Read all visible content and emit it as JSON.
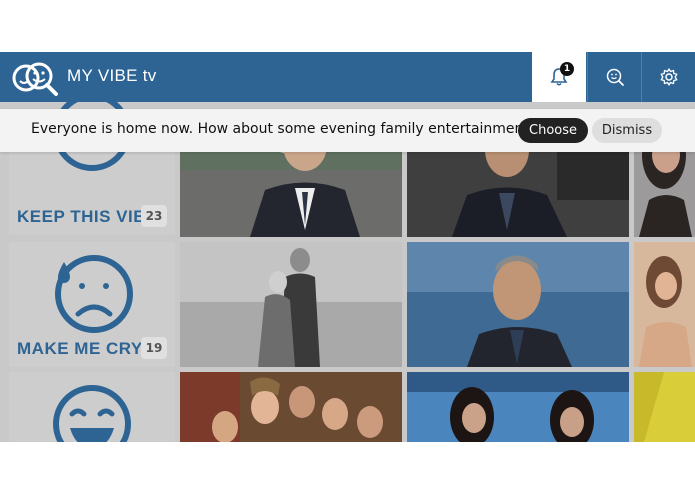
{
  "app": {
    "title": "MY VIBE tv",
    "accent": "#2e6494"
  },
  "header": {
    "notifications": {
      "icon": "bell-icon",
      "count": "1"
    },
    "mood_button": {
      "icon": "smiley-search-icon"
    },
    "settings_button": {
      "icon": "gear-icon"
    }
  },
  "notification": {
    "message": "Everyone is home now. How about some evening family entertainment?",
    "choose_label": "Choose",
    "dismiss_label": "Dismiss"
  },
  "moods": [
    {
      "label": "KEEP THIS VIBE",
      "count": "23",
      "icon": "neutral-face-icon"
    },
    {
      "label": "MAKE ME CRY",
      "count": "19",
      "icon": "sad-face-icon"
    },
    {
      "label": "",
      "count": "",
      "icon": "laughing-face-icon"
    }
  ],
  "rows": [
    {
      "tiles": [
        {
          "icon": "man-in-suit-outdoors-thumbnail"
        },
        {
          "icon": "man-in-dark-suit-thumbnail"
        },
        {
          "icon": "woman-portrait-thumbnail"
        }
      ]
    },
    {
      "tiles": [
        {
          "icon": "black-and-white-couple-thumbnail"
        },
        {
          "icon": "man-portrait-stadium-thumbnail"
        },
        {
          "icon": "woman-portrait-thumbnail"
        }
      ]
    },
    {
      "tiles": [
        {
          "icon": "sitcom-group-thumbnail"
        },
        {
          "icon": "two-women-red-carpet-thumbnail"
        },
        {
          "icon": "yellow-abstract-thumbnail"
        }
      ]
    }
  ]
}
